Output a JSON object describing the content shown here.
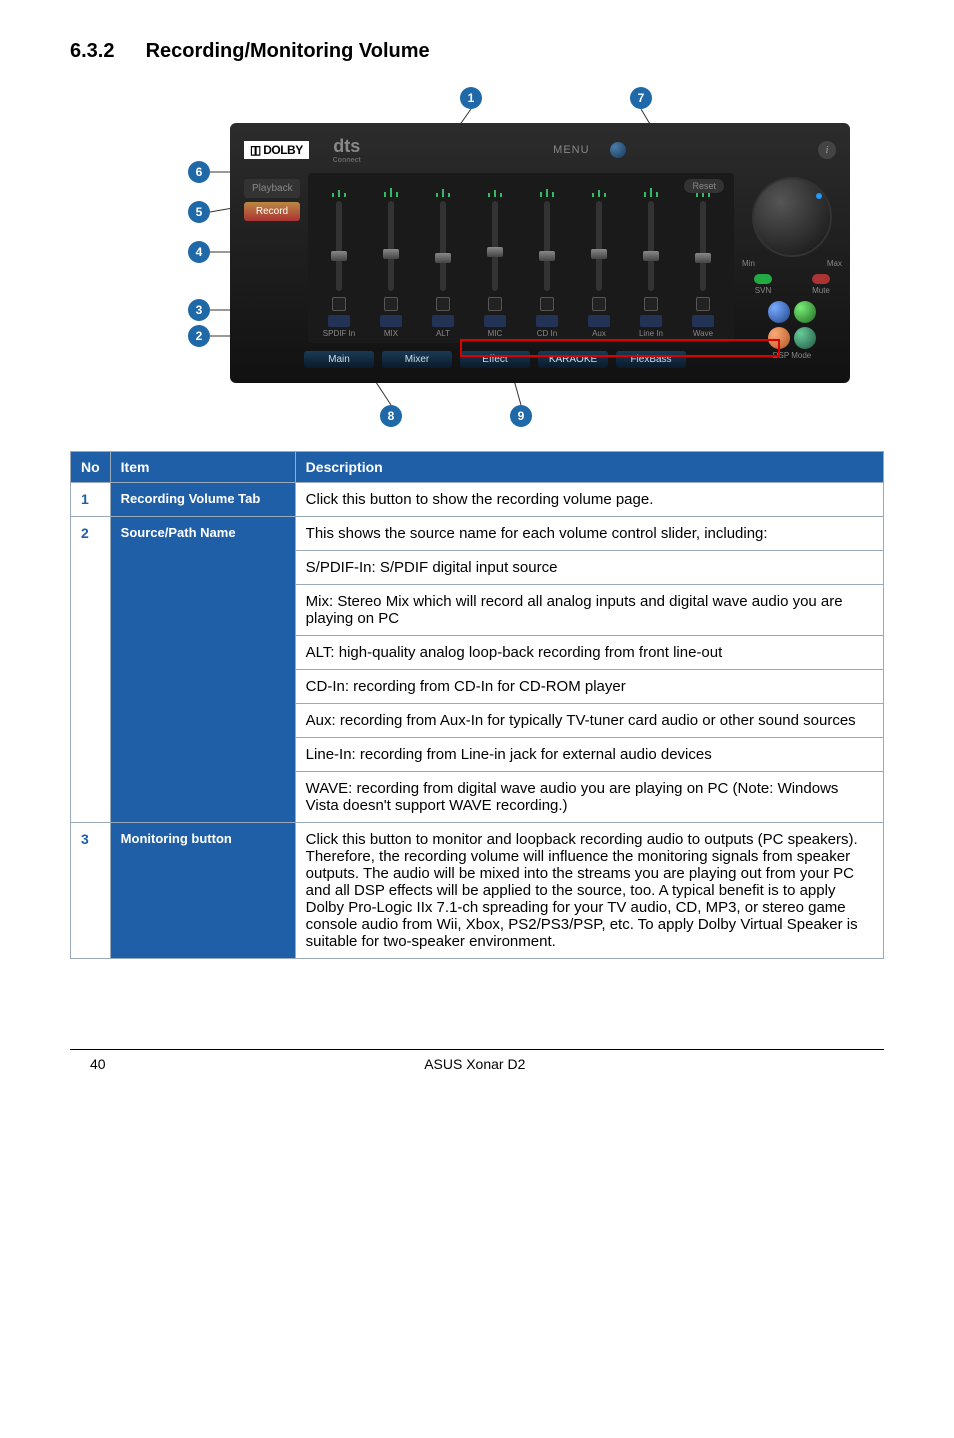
{
  "heading": {
    "number": "6.3.2",
    "title": "Recording/Monitoring Volume"
  },
  "callouts": {
    "n1": "1",
    "n2": "2",
    "n3": "3",
    "n4": "4",
    "n5": "5",
    "n6": "6",
    "n7": "7",
    "n8": "8",
    "n9": "9"
  },
  "panel": {
    "dolby_prefix": "▯▯",
    "dolby": "DOLBY",
    "dts": "dts",
    "dts_sub": "Connect",
    "menu": "MENU",
    "tab_playback": "Playback",
    "tab_record": "Record",
    "reset": "Reset",
    "min": "Min",
    "max": "Max",
    "svm": "SVN",
    "mute": "Mute",
    "dsp": "DSP Mode",
    "bottom": {
      "main": "Main",
      "mixer": "Mixer",
      "effect": "Effect",
      "karaoke": "KARAOKE",
      "flexbass": "FlexBass"
    },
    "channels": [
      "SPDIF In",
      "MIX",
      "ALT",
      "MIC",
      "CD In",
      "Aux",
      "Line In",
      "Wave"
    ]
  },
  "table": {
    "headers": {
      "no": "No",
      "item": "Item",
      "desc": "Description"
    },
    "rows": [
      {
        "no": "1",
        "item": "Recording Volume Tab",
        "cells": [
          "Click this button to show the recording volume page."
        ]
      },
      {
        "no": "2",
        "item": "Source/Path Name",
        "cells": [
          "This shows the source name for each volume control slider, including:",
          "S/PDIF-In: S/PDIF digital input source",
          "Mix: Stereo Mix which will record all analog inputs and digital wave audio you are playing on PC",
          "ALT: high-quality analog loop-back recording from front line-out",
          "CD-In: recording from CD-In for CD-ROM player",
          "Aux: recording from Aux-In for typically TV-tuner card audio or other sound sources",
          "Line-In: recording from Line-in jack for external audio devices",
          "WAVE: recording from digital wave audio you are playing on PC (Note: Windows Vista doesn't support WAVE recording.)"
        ]
      },
      {
        "no": "3",
        "item": "Monitoring button",
        "cells": [
          "Click this button to monitor and loopback recording audio to outputs (PC speakers). Therefore, the recording volume will influence the monitoring signals from speaker outputs. The audio will be mixed into the streams you are playing out from your PC and all DSP effects will be applied to the source, too. A typical benefit is to apply Dolby Pro-Logic IIx 7.1-ch spreading for your TV audio, CD, MP3, or stereo game console audio from Wii, Xbox, PS2/PS3/PSP, etc. To apply Dolby Virtual Speaker is suitable for two-speaker environment."
        ]
      }
    ]
  },
  "footer": {
    "page": "40",
    "product": "ASUS Xonar D2"
  }
}
